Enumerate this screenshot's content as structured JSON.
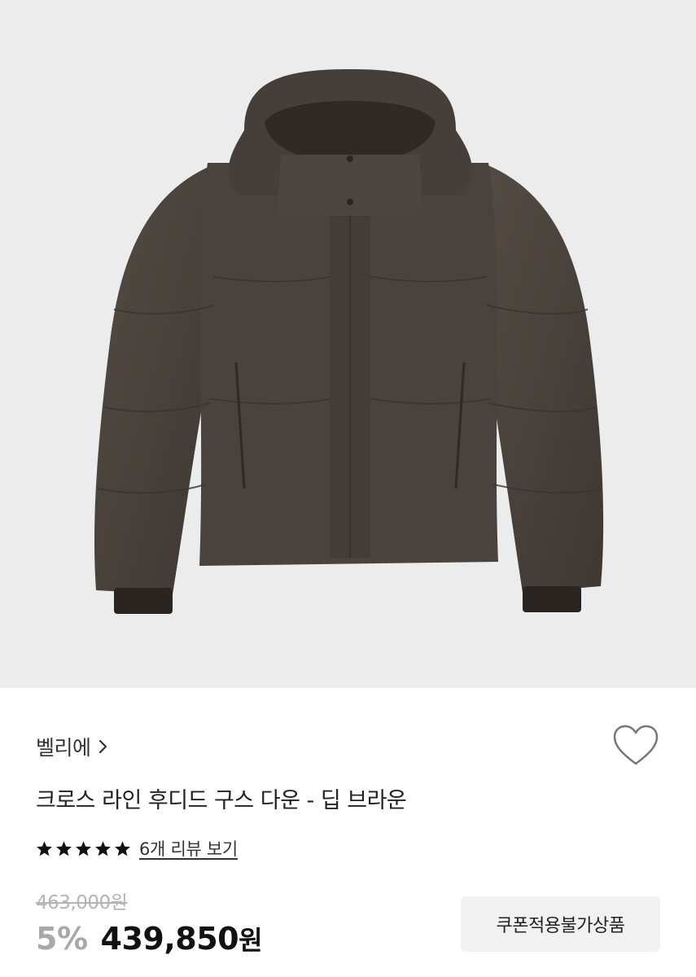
{
  "product": {
    "image_alt": "product-photo",
    "brand": "벨리에",
    "title": "크로스 라인 후디드 구스 다운 - 딥 브라운",
    "rating_stars": 5,
    "review_link": "6개 리뷰 보기",
    "original_price": "463,000원",
    "discount": "5%",
    "sale_price_number": "439,850",
    "sale_price_unit": "원",
    "coupon_badge": "쿠폰적용불가상품"
  },
  "icons": {
    "chevron": "chevron-right-icon",
    "like": "heart-outline-icon",
    "star": "star-icon"
  },
  "colors": {
    "jacket": "#4a433d",
    "background": "#ececec",
    "star": "#111111",
    "discount": "#a8a8a8"
  }
}
